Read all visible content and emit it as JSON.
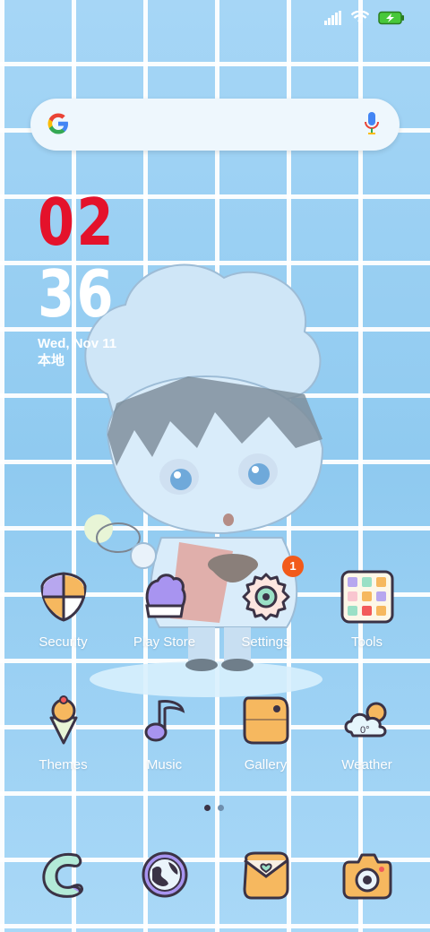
{
  "status_bar": {
    "icons": [
      "signal-icon",
      "wifi-icon",
      "battery-charging-icon"
    ]
  },
  "search": {
    "placeholder": ""
  },
  "clock": {
    "hour": "02",
    "minute": "36",
    "date": "Wed, Nov 11",
    "location": "本地"
  },
  "apps_row1": [
    {
      "label": "Security",
      "icon": "shield-icon"
    },
    {
      "label": "Play Store",
      "icon": "glove-icon"
    },
    {
      "label": "Settings",
      "icon": "gear-icon",
      "badge": "1"
    },
    {
      "label": "Tools",
      "icon": "folder-grid-icon"
    }
  ],
  "apps_row2": [
    {
      "label": "Themes",
      "icon": "ice-cream-icon"
    },
    {
      "label": "Music",
      "icon": "music-note-icon"
    },
    {
      "label": "Gallery",
      "icon": "gallery-icon"
    },
    {
      "label": "Weather",
      "icon": "cloud-sun-icon"
    }
  ],
  "weather_icon_text": "0°",
  "page_indicator": {
    "pages": 2,
    "current": 1
  },
  "dock": [
    "phone-icon",
    "browser-globe-icon",
    "messages-envelope-icon",
    "camera-icon"
  ],
  "colors": {
    "accent_red": "#e4122b",
    "badge": "#f25a1a",
    "icon_outline": "#3b3346"
  }
}
